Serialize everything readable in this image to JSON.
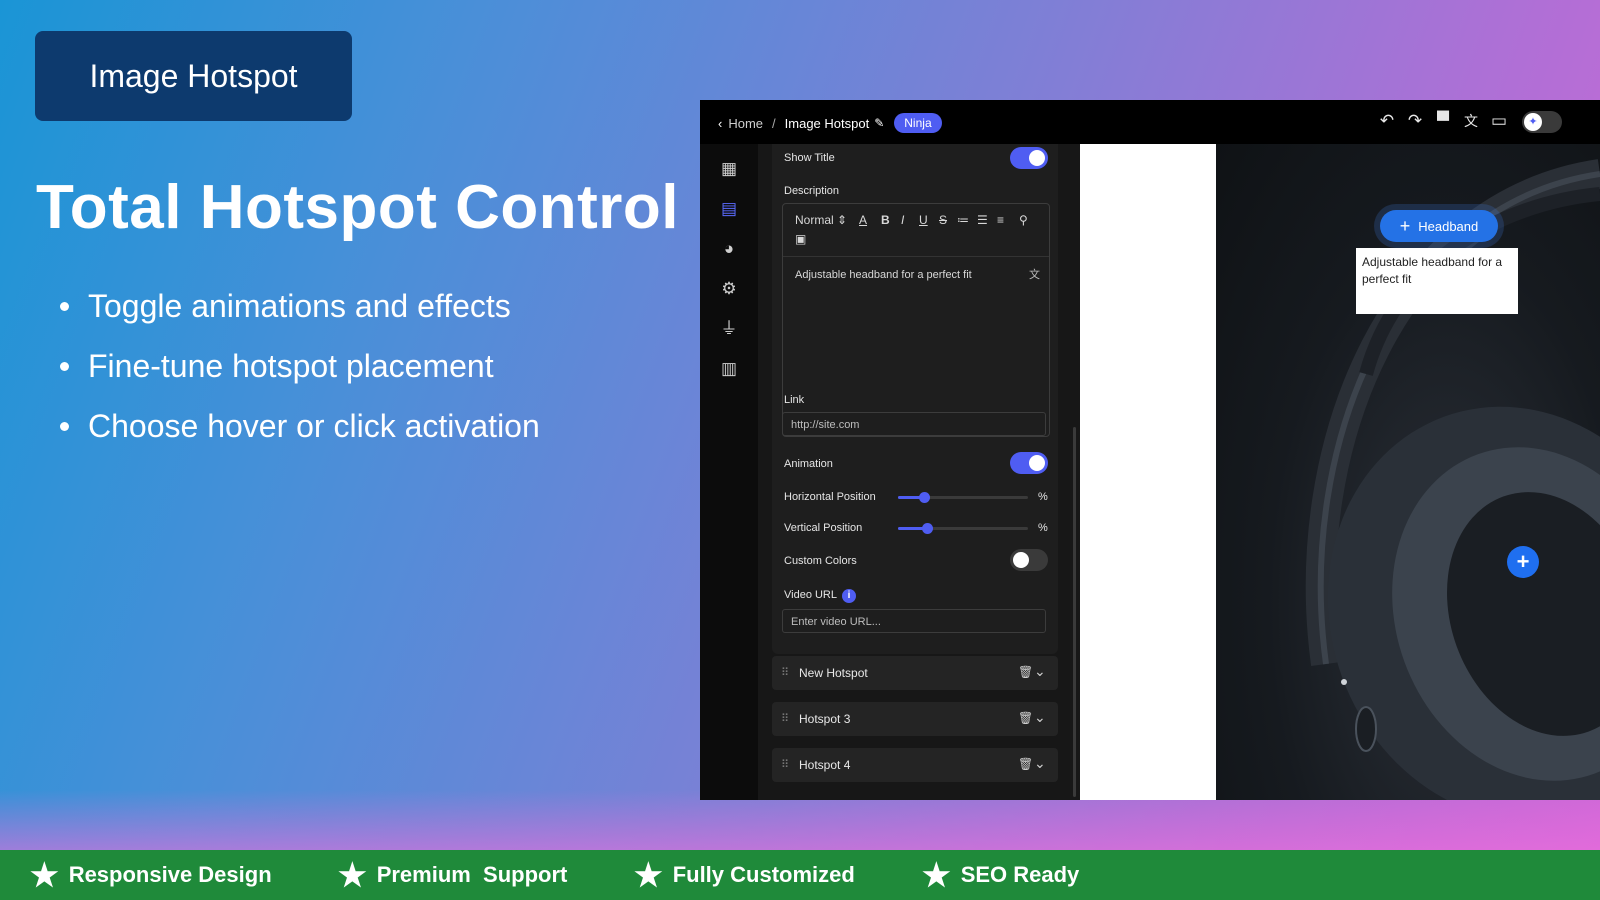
{
  "badge": {
    "label": "Image Hotspot"
  },
  "hero": {
    "title": "Total Hotspot Control",
    "bullets": [
      "Toggle animations and effects",
      "Fine-tune hotspot placement",
      "Choose hover or click activation"
    ]
  },
  "app": {
    "breadcrumb": {
      "home": "Home",
      "separator": "/",
      "current": "Image Hotspot",
      "tag": "Ninja"
    },
    "toolbar_icons": [
      "undo-icon",
      "redo-icon",
      "paint-roller-icon",
      "translate-icon",
      "desktop-icon",
      "ai-toggle-icon"
    ],
    "sidebar_icons": [
      "dashboard-icon",
      "table-icon",
      "palette-icon",
      "gear-icon",
      "plug-icon",
      "chart-icon"
    ],
    "panel": {
      "show_title_label": "Show Title",
      "show_title_on": true,
      "description_label": "Description",
      "editor": {
        "format": "Normal",
        "text": "Adjustable headband for a perfect fit"
      },
      "link_label": "Link",
      "link_value": "http://site.com",
      "animation_label": "Animation",
      "animation_on": true,
      "horizontal_label": "Horizontal Position",
      "horizontal_value": 20,
      "vertical_label": "Vertical Position",
      "vertical_value": 22,
      "unit": "%",
      "custom_colors_label": "Custom Colors",
      "custom_colors_on": false,
      "video_label": "Video URL",
      "video_placeholder": "Enter video URL...",
      "hotspots": [
        "New Hotspot",
        "Hotspot 3",
        "Hotspot 4"
      ]
    },
    "preview": {
      "hotspot_label": "Headband",
      "tooltip": "Adjustable headband for a perfect fit"
    },
    "accent": "#4f5df2"
  },
  "footer": {
    "features": [
      "Responsive Design",
      "Premium  Support",
      "Fully Customized",
      "SEO Ready"
    ],
    "bg": "#1f8a3a"
  }
}
